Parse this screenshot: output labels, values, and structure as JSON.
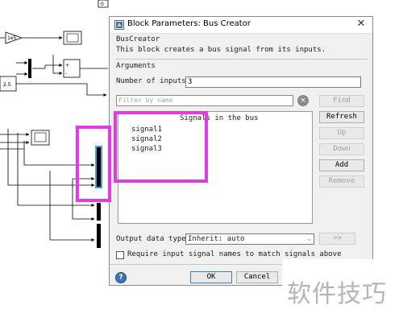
{
  "model": {
    "gain_label": "1e5",
    "constant_label": "2.5",
    "top_block_label": "0",
    "sum_signs": [
      "+",
      "-"
    ]
  },
  "dialog": {
    "title": "Block Parameters: Bus Creator",
    "block_name": "BusCreator",
    "description": "This block creates a bus signal from its inputs.",
    "arguments_label": "Arguments",
    "num_inputs_label": "Number of inputs:",
    "num_inputs_value": "3",
    "filter_placeholder": "Filter by name",
    "buttons": {
      "find": "Find",
      "refresh": "Refresh",
      "up": "Up",
      "down": "Down",
      "add": "Add",
      "remove": "Remove",
      "expand": ">>",
      "ok": "OK",
      "cancel": "Cancel"
    },
    "list_header": "Signals in the bus",
    "signals": [
      "signal1",
      "signal2",
      "signal3"
    ],
    "output_type_label": "Output data type:",
    "output_type_value": "Inherit: auto",
    "require_label": "Require input signal names to match signals above",
    "require_checked": false
  },
  "watermark": "软件技巧",
  "colors": {
    "annotation": "#e23be2",
    "selection": "#4aa3df",
    "help": "#3f72b7"
  },
  "icons": {
    "title": "block-parameters-icon",
    "close": "close-icon",
    "clear": "clear-filter-icon",
    "help": "help-icon",
    "chevron": "chevron-down-icon"
  }
}
